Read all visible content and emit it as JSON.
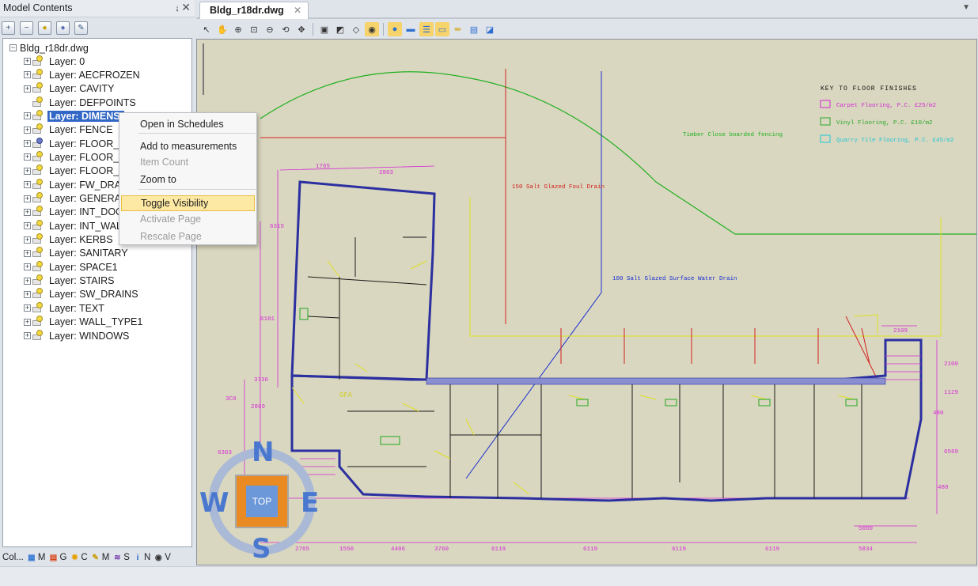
{
  "left_panel": {
    "title": "Model Contents",
    "pin_glyph": "⭭",
    "close_glyph": "✕",
    "toolbar_icons": [
      "expand-all-icon",
      "collapse-all-icon",
      "show-layers-icon",
      "hide-layers-icon",
      "settings-icon"
    ],
    "root_label": "Bldg_r18dr.dwg",
    "root_expander": "−",
    "layers": [
      {
        "label": "Layer: 0",
        "expander": "+",
        "bulb": "on"
      },
      {
        "label": "Layer: AECFROZEN",
        "expander": "+",
        "bulb": "on"
      },
      {
        "label": "Layer: CAVITY",
        "expander": "+",
        "bulb": "on"
      },
      {
        "label": "Layer: DEFPOINTS",
        "expander": "",
        "bulb": "on"
      },
      {
        "label": "Layer: DIMENSI",
        "expander": "+",
        "bulb": "on",
        "selected": true
      },
      {
        "label": "Layer: FENCE",
        "expander": "+",
        "bulb": "on"
      },
      {
        "label": "Layer: FLOOR_FII",
        "expander": "+",
        "bulb": "off"
      },
      {
        "label": "Layer: FLOOR_FII",
        "expander": "+",
        "bulb": "on"
      },
      {
        "label": "Layer: FLOOR_FII",
        "expander": "+",
        "bulb": "on"
      },
      {
        "label": "Layer: FW_DRAIN",
        "expander": "+",
        "bulb": "on"
      },
      {
        "label": "Layer: GENERAL",
        "expander": "+",
        "bulb": "on"
      },
      {
        "label": "Layer: INT_DOOR",
        "expander": "+",
        "bulb": "on"
      },
      {
        "label": "Layer: INT_WALLS",
        "expander": "+",
        "bulb": "on"
      },
      {
        "label": "Layer: KERBS",
        "expander": "+",
        "bulb": "on"
      },
      {
        "label": "Layer: SANITARY",
        "expander": "+",
        "bulb": "on"
      },
      {
        "label": "Layer: SPACE1",
        "expander": "+",
        "bulb": "on"
      },
      {
        "label": "Layer: STAIRS",
        "expander": "+",
        "bulb": "on"
      },
      {
        "label": "Layer: SW_DRAINS",
        "expander": "+",
        "bulb": "on"
      },
      {
        "label": "Layer: TEXT",
        "expander": "+",
        "bulb": "on"
      },
      {
        "label": "Layer: WALL_TYPE1",
        "expander": "+",
        "bulb": "on"
      },
      {
        "label": "Layer: WINDOWS",
        "expander": "+",
        "bulb": "on"
      }
    ],
    "bottom_tabs": [
      {
        "label": "Col...",
        "icon": ""
      },
      {
        "label": "M",
        "icon": "model-icon"
      },
      {
        "label": "G",
        "icon": "grid-icon"
      },
      {
        "label": "C",
        "icon": "compass-icon"
      },
      {
        "label": "M",
        "icon": "measure-icon"
      },
      {
        "label": "S",
        "icon": "sections-icon"
      },
      {
        "label": "N",
        "icon": "info-icon"
      },
      {
        "label": "V",
        "icon": "eye-icon"
      }
    ]
  },
  "document": {
    "tab_label": "Bldg_r18dr.dwg",
    "tab_close": "✕",
    "dropdown_glyph": "▼",
    "toolbar_icons": [
      "select-icon",
      "pan-icon",
      "zoom-in-icon",
      "zoom-window-icon",
      "zoom-out-icon",
      "zoom-previous-icon",
      "orbit-icon",
      "front-view-icon",
      "iso-view-icon",
      "wireframe-icon",
      "shaded-icon",
      "layers-icon",
      "properties-icon",
      "markup-icon",
      "measure-icon",
      "pen-icon",
      "notes-icon",
      "fullscreen-icon"
    ]
  },
  "context_menu": {
    "items": [
      {
        "label": "Open in Schedules",
        "enabled": true
      },
      {
        "label": "Add to measurements",
        "enabled": true
      },
      {
        "label": "Item Count",
        "enabled": false
      },
      {
        "label": "Zoom to",
        "enabled": true
      },
      {
        "label": "Toggle Visibility",
        "enabled": true,
        "highlighted": true
      },
      {
        "label": "Activate Page",
        "enabled": false
      },
      {
        "label": "Rescale Page",
        "enabled": false
      }
    ]
  },
  "compass": {
    "north": "N",
    "south": "S",
    "east": "E",
    "west": "W",
    "center_label": "TOP"
  },
  "drawing": {
    "key_title": "KEY TO FLOOR FINISHES",
    "key_items": [
      {
        "label": "Carpet Flooring, P.C. £25/m2",
        "color": "#d22ad6"
      },
      {
        "label": "Vinyl Flooring, P.C. £10/m2",
        "color": "#2aa82a"
      },
      {
        "label": "Quarry Tile Flooring, P.C. £45/m2",
        "color": "#22c6d8"
      }
    ],
    "notes": [
      "Timber Close boarded fencing",
      "150 Salt Glazed Foul Drain",
      "100 Salt Glazed Surface Water Drain"
    ],
    "room_label": "GFA",
    "dimensions": [
      "1765",
      "2863",
      "6315",
      "6181",
      "3736",
      "2869",
      "3C0",
      "6363",
      "2765",
      "1550",
      "4406",
      "3760",
      "6119",
      "6119",
      "6119",
      "6119",
      "5834",
      "2109",
      "2100",
      "1129",
      "480",
      "6569",
      "480",
      "5000"
    ]
  }
}
